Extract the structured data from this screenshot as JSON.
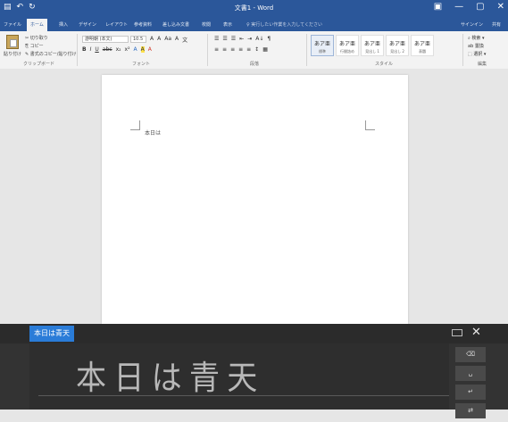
{
  "titlebar": {
    "title": "文書1 - Word",
    "qat": [
      "▤",
      "↶",
      "↻"
    ],
    "controls": [
      "▣",
      "—",
      "▢",
      "✕"
    ]
  },
  "ribbon_tabs": [
    {
      "label": "ファイル",
      "active": false
    },
    {
      "label": "ホーム",
      "active": true
    },
    {
      "label": "挿入",
      "active": false
    },
    {
      "label": "デザイン",
      "active": false
    },
    {
      "label": "レイアウト",
      "active": false
    },
    {
      "label": "参考資料",
      "active": false
    },
    {
      "label": "差し込み文書",
      "active": false
    },
    {
      "label": "校閲",
      "active": false
    },
    {
      "label": "表示",
      "active": false
    }
  ],
  "tell_me": "♀ 実行したい作業を入力してください",
  "tabs_right": [
    "サインイン",
    "共有"
  ],
  "ribbon": {
    "clipboard": {
      "paste": "貼り付け",
      "cut": "✂ 切り取り",
      "copy": "⎘ コピー",
      "painter": "✎ 書式のコピー/貼り付け",
      "group": "クリップボード"
    },
    "font": {
      "name": "游明朝 (本文)",
      "size": "10.5",
      "row1": [
        "A",
        "A",
        "Aa",
        "A",
        "文"
      ],
      "row2": [
        "B",
        "I",
        "U",
        "abc",
        "x₂",
        "x²",
        "A",
        "A",
        "A"
      ],
      "group": "フォント"
    },
    "paragraph": {
      "row1": [
        "☰",
        "☰",
        "☰",
        "⇤",
        "⇥",
        "A↓",
        "¶"
      ],
      "row2": [
        "≡",
        "≡",
        "≡",
        "≡",
        "≡",
        "↕",
        "▦"
      ],
      "group": "段落"
    },
    "styles": {
      "items": [
        {
          "big": "あア亜",
          "name": "標準",
          "selected": true
        },
        {
          "big": "あア亜",
          "name": "行間詰め",
          "selected": false
        },
        {
          "big": "あア亜",
          "name": "見出し 1",
          "selected": false
        },
        {
          "big": "あア亜",
          "name": "見出し 2",
          "selected": false
        },
        {
          "big": "あア亜",
          "name": "表題",
          "selected": false
        }
      ],
      "group": "スタイル"
    },
    "editing": {
      "items": [
        "⌕ 検索 ▾",
        "ab 置換",
        "⬚ 選択 ▾"
      ],
      "group": "編集"
    }
  },
  "document": {
    "typed_text": "本日は"
  },
  "handwriting": {
    "candidate": "本日は青天",
    "ink_text": "本日は青天",
    "buttons": [
      "⌫",
      "␣",
      "↵",
      "⇄"
    ]
  }
}
